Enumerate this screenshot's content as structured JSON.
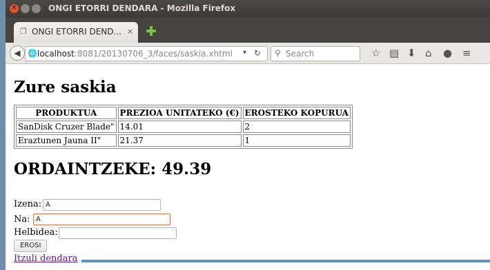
{
  "window": {
    "title": "ONGI ETORRI DENDARA - Mozilla Firefox"
  },
  "tab": {
    "label": "ONGI ETORRI DEND...",
    "close_glyph": "×"
  },
  "nav": {
    "url_host": "localhost",
    "url_rest": ":8081/20130706_3/faces/saskia.xhtml",
    "search_placeholder": "Search"
  },
  "page": {
    "heading": "Zure saskia",
    "table": {
      "headers": [
        "PRODUKTUA",
        "PREZIOA UNITATEKO (€)",
        "EROSTEKO KOPURUA"
      ],
      "rows": [
        [
          "SanDisk Cruzer Blade\"",
          "14.01",
          "2"
        ],
        [
          "Eraztunen Jauna II\"",
          "21.37",
          "1"
        ]
      ]
    },
    "total": "ORDAINTZEKE: 49.39",
    "form": {
      "name_label": "Izena:",
      "name_value": "A",
      "surname_label": "Na:",
      "surname_value": "A",
      "address_label": "Helbidea:",
      "address_value": "",
      "submit_label": "EROSI"
    },
    "back_link": "Itzuli dendara"
  },
  "colors": {
    "accent_focus": "#e2774c",
    "link_visited": "#551a8b",
    "new_tab_green": "#79c442"
  }
}
